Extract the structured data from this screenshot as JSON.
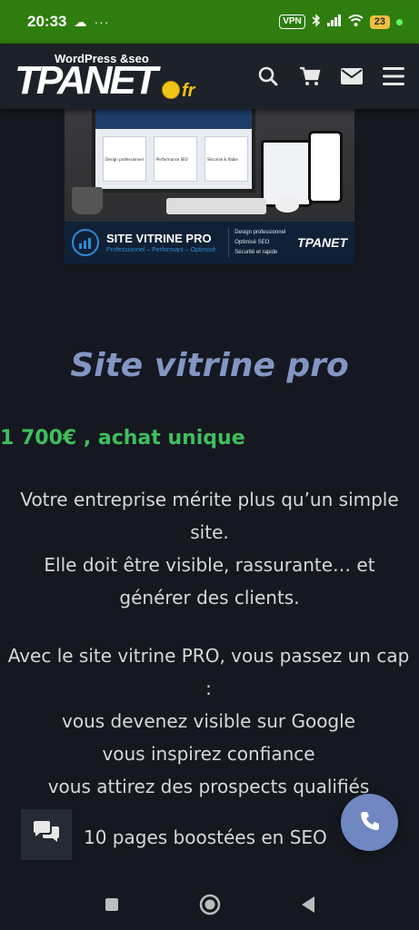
{
  "status_bar": {
    "time": "20:33",
    "cloud_icon": "☁",
    "dots": "···",
    "vpn": "VPN",
    "battery": "23",
    "icons": [
      "bluetooth-icon",
      "signal-icon",
      "wifi-icon",
      "battery-icon"
    ]
  },
  "header": {
    "logo_tagline": "WordPress &seo",
    "logo_main": "TPANET",
    "logo_ext": "fr",
    "icons": [
      "search-icon",
      "cart-icon",
      "mail-icon",
      "menu-icon"
    ]
  },
  "hero": {
    "banner_title": "SITE VITRINE PRO",
    "banner_subtitle": "Professionnel – Performant – Optimisé",
    "banner_features": [
      "Design professionnel",
      "Optimisé SEO",
      "Sécurité et rapide"
    ],
    "banner_logo": "TPANET",
    "card_labels": [
      "Design professionnel",
      "Performance SEO",
      "Sécurisé & fiable"
    ]
  },
  "content": {
    "title": "Site vitrine pro",
    "price": "1 700€ , achat unique",
    "para1_line1": "Votre entreprise mérite plus qu’un simple",
    "para1_line2": "site.",
    "para1_line3": "Elle doit être visible, rassurante… et",
    "para1_line4": "générer des clients.",
    "para2_line1": "Avec le site vitrine PRO, vous passez un cap",
    "para2_line2": ":",
    "para2_line3": "vous devenez visible sur Google",
    "para2_line4": "vous inspirez confiance",
    "para2_line5": "vous attirez des prospects qualifiés",
    "seo_line": "10 pages boostées en SEO"
  },
  "colors": {
    "status_bar": "#2e7d0e",
    "header_bg": "#1d2129",
    "page_bg": "#151820",
    "title": "#8395c4",
    "price": "#3fbf5c",
    "call_button": "#7187c1"
  }
}
